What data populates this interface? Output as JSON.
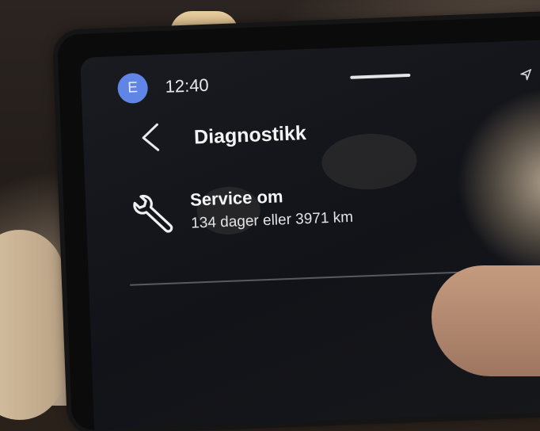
{
  "status_bar": {
    "avatar_letter": "E",
    "time": "12:40"
  },
  "header": {
    "back_icon": "chevron-left-icon",
    "title": "Diagnostikk"
  },
  "service": {
    "icon": "wrench-icon",
    "title": "Service om",
    "detail": "134 dager eller 3971 km"
  },
  "colors": {
    "screen_bg": "#16171b",
    "avatar": "#5f86e6",
    "text": "#f2f3f4",
    "divider": "#585a60"
  }
}
